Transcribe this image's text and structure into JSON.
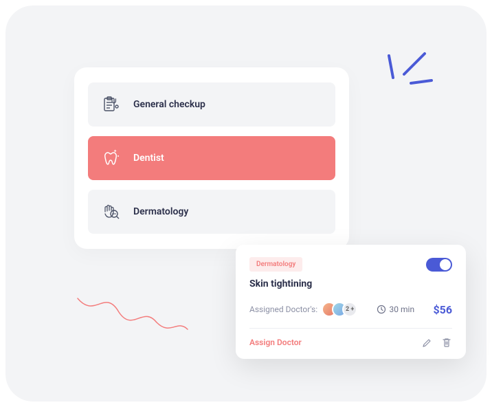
{
  "categories": {
    "items": [
      {
        "label": "General checkup",
        "active": false
      },
      {
        "label": "Dentist",
        "active": true
      },
      {
        "label": "Dermatology",
        "active": false
      }
    ]
  },
  "detail": {
    "badge": "Dermatology",
    "title": "Skin tightining",
    "assigned_label": "Assigned Doctor's:",
    "extra_count": "2 +",
    "duration": "30 min",
    "price": "$56",
    "assign_link": "Assign Doctor",
    "toggle_on": true
  }
}
